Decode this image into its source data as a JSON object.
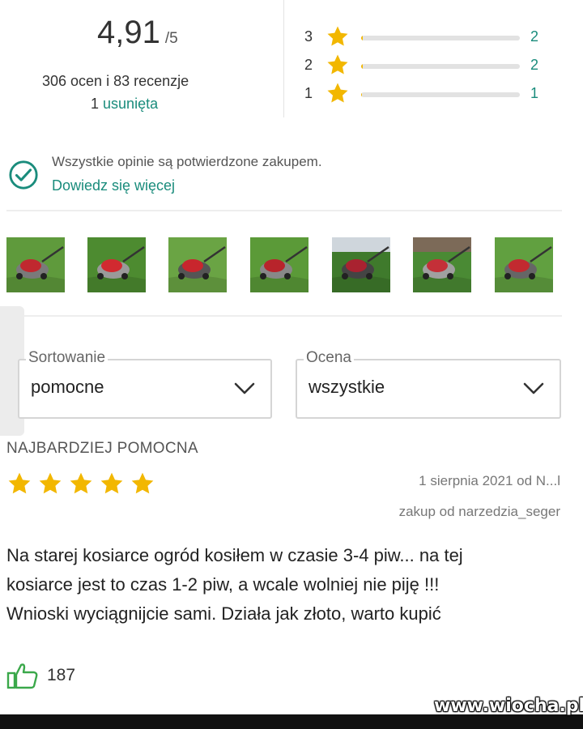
{
  "summary": {
    "score": "4,91",
    "scale": "/5",
    "counts": "306 ocen i 83 recenzje",
    "removed_prefix": "1",
    "removed_link": "usunięta"
  },
  "distribution": [
    {
      "stars": "3",
      "count": "2",
      "fraction": 0.01
    },
    {
      "stars": "2",
      "count": "2",
      "fraction": 0.01
    },
    {
      "stars": "1",
      "count": "1",
      "fraction": 0.005
    }
  ],
  "verification": {
    "text": "Wszystkie opinie są potwierdzone zakupem.",
    "link": "Dowiedz się więcej"
  },
  "photos": [
    "lawn-mower-photo",
    "lawn-mower-photo",
    "lawn-mower-photo",
    "lawn-mower-photo",
    "lawn-mower-photo",
    "lawn-mower-photo",
    "lawn-mower-photo"
  ],
  "filters": {
    "sort": {
      "label": "Sortowanie",
      "value": "pomocne"
    },
    "rating": {
      "label": "Ocena",
      "value": "wszystkie"
    }
  },
  "review": {
    "section_title": "NAJBARDZIEJ POMOCNA",
    "rating": 5,
    "date_author": "1 sierpnia 2021 od N...l",
    "seller": "zakup od narzedzia_seger",
    "text_lines": [
      "Na starej kosiarce ogród kosiłem w czasie 3-4 piw... na tej",
      "kosiarce jest to czas 1-2 piw, a wcale wolniej nie piję !!!",
      "Wnioski wyciągnijcie sami. Działa jak złoto, warto kupić"
    ],
    "likes": "187"
  },
  "watermark": "www.wiocha.pl",
  "colors": {
    "accent": "#1a8c7c",
    "star": "#f2b700",
    "text": "#222222"
  }
}
